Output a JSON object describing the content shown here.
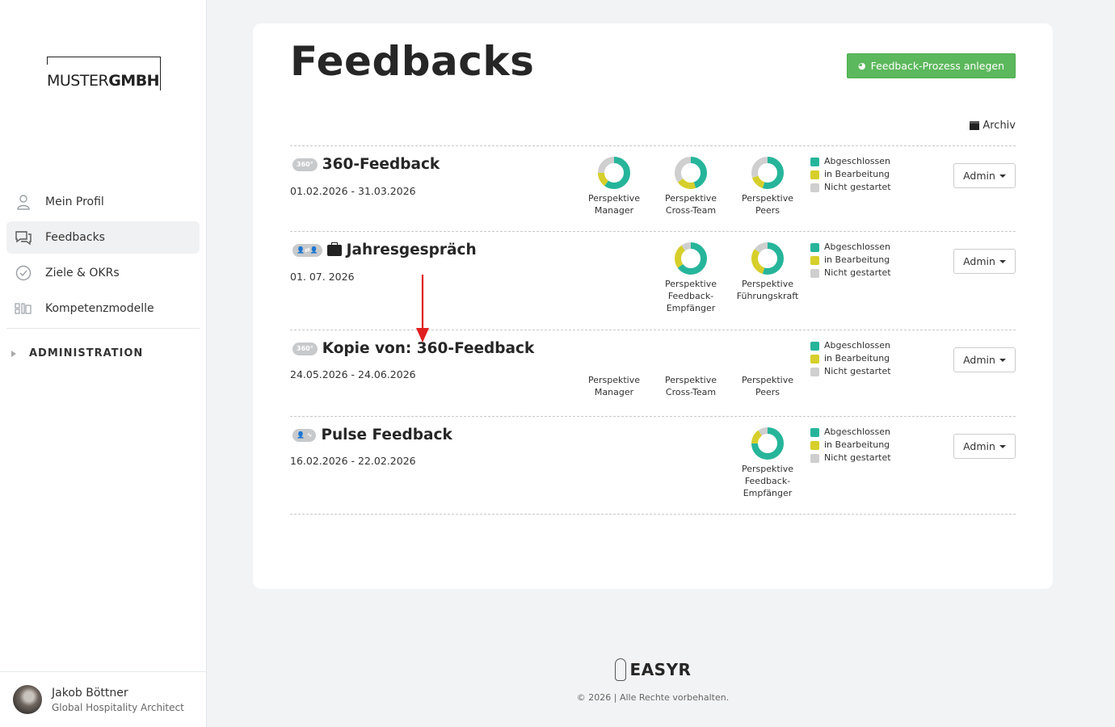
{
  "brand": {
    "logo_left": "MUSTER",
    "logo_right": "GMBH"
  },
  "sidebar": {
    "items": [
      {
        "label": "Mein Profil",
        "icon": "user-icon",
        "active": false
      },
      {
        "label": "Feedbacks",
        "icon": "chat-bubbles-icon",
        "active": true
      },
      {
        "label": "Ziele & OKRs",
        "icon": "check-circle-icon",
        "active": false
      },
      {
        "label": "Kompetenzmodelle",
        "icon": "grid-icon",
        "active": false
      }
    ],
    "admin_label": "ADMINISTRATION"
  },
  "user": {
    "name": "Jakob Böttner",
    "role": "Global Hospitality Architect"
  },
  "main": {
    "title": "Feedbacks",
    "new_button": "Feedback-Prozess anlegen",
    "archive_label": "Archiv",
    "legend": [
      "Abgeschlossen",
      "in Bearbeitung",
      "Nicht gestartet"
    ],
    "admin_label": "Admin",
    "colors": {
      "done": "#26b59a",
      "in_progress": "#d6cf2b",
      "not_started": "#cfcfcf"
    },
    "rows": [
      {
        "badge": "360°",
        "title": "360-Feedback",
        "date": "01.02.2026 - 31.03.2026",
        "perspectives": [
          {
            "label_1": "Perspektive",
            "label_2": "Manager",
            "label_3": "",
            "done": 0.6,
            "in_progress": 0.15,
            "not_started": 0.25
          },
          {
            "label_1": "Perspektive",
            "label_2": "Cross-Team",
            "label_3": "",
            "done": 0.45,
            "in_progress": 0.2,
            "not_started": 0.35
          },
          {
            "label_1": "Perspektive",
            "label_2": "Peers",
            "label_3": "",
            "done": 0.55,
            "in_progress": 0.15,
            "not_started": 0.3
          }
        ]
      },
      {
        "badge": "👤⇄👤",
        "title": "Jahresgespräch",
        "date": "01. 07. 2026",
        "perspectives": [
          {
            "label_1": "Perspektive",
            "label_2": "Feedback-",
            "label_3": "Empfänger",
            "done": 0.65,
            "in_progress": 0.25,
            "not_started": 0.1
          },
          {
            "label_1": "Perspektive",
            "label_2": "Führungskraft",
            "label_3": "",
            "done": 0.55,
            "in_progress": 0.3,
            "not_started": 0.15
          }
        ]
      },
      {
        "badge": "360°",
        "title": "Kopie von: 360-Feedback",
        "date": "24.05.2026 - 24.06.2026",
        "perspectives": [
          {
            "label_1": "Perspektive",
            "label_2": "Manager",
            "label_3": ""
          },
          {
            "label_1": "Perspektive",
            "label_2": "Cross-Team",
            "label_3": ""
          },
          {
            "label_1": "Perspektive",
            "label_2": "Peers",
            "label_3": ""
          }
        ]
      },
      {
        "badge": "👤 ∿",
        "title": "Pulse Feedback",
        "date": "16.02.2026 - 22.02.2026",
        "perspectives": [
          {
            "label_1": "Perspektive",
            "label_2": "Feedback-",
            "label_3": "Empfänger",
            "done": 0.75,
            "in_progress": 0.15,
            "not_started": 0.1
          }
        ]
      }
    ]
  },
  "footer": {
    "brand": "EASYR",
    "copyright": "© 2026 | Alle Rechte vorbehalten."
  }
}
